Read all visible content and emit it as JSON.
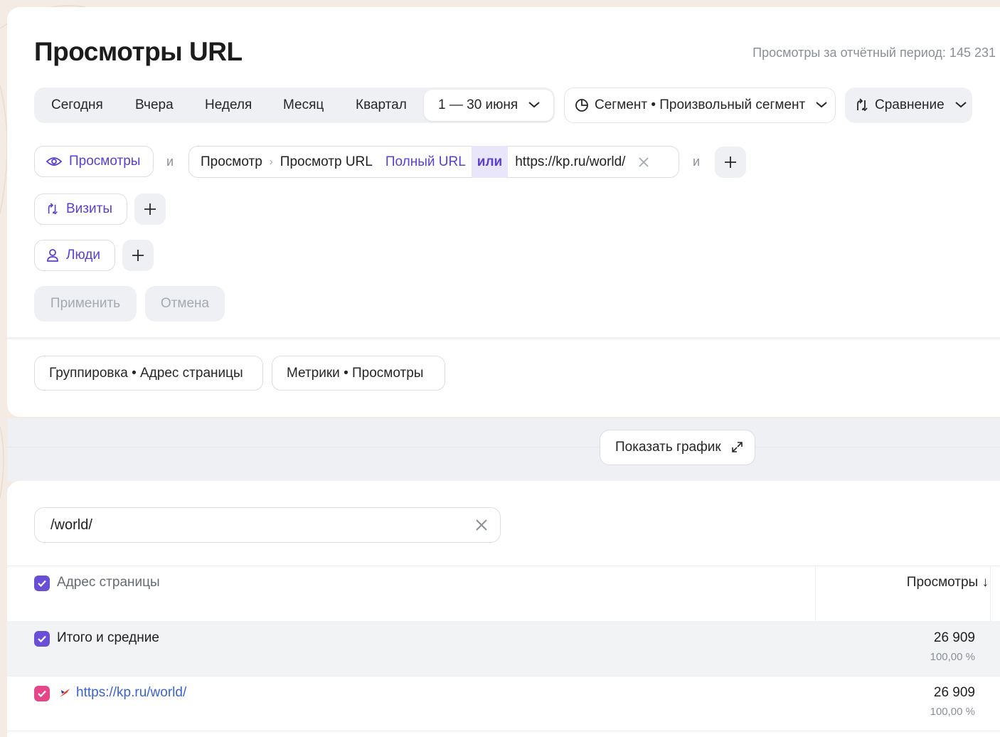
{
  "header": {
    "title": "Просмотры URL",
    "period_total": "Просмотры за отчётный период: 145 231"
  },
  "date_bar": {
    "today": "Сегодня",
    "yesterday": "Вчера",
    "week": "Неделя",
    "month": "Месяц",
    "quarter": "Квартал",
    "range": "1 — 30 июня"
  },
  "segment": {
    "label": "Сегмент • Произвольный сегмент"
  },
  "compare": {
    "label": "Сравнение"
  },
  "filters": {
    "views_chip": "Просмотры",
    "and": "и",
    "condition": {
      "crumb_1": "Просмотр",
      "crumb_2": "Просмотр URL",
      "field": "Полный URL",
      "operator": "или",
      "value": "https://kp.ru/world/"
    },
    "visits_chip": "Визиты",
    "people_chip": "Люди"
  },
  "actions": {
    "apply": "Применить",
    "cancel": "Отмена"
  },
  "settings": {
    "grouping": "Группировка • Адрес страницы",
    "metrics": "Метрики • Просмотры"
  },
  "chart_toggle": {
    "label": "Показать график"
  },
  "search": {
    "value": "/world/"
  },
  "table": {
    "header_dimension": "Адрес страницы",
    "header_metric": "Просмотры ↓",
    "rows": [
      {
        "label": "Итого и средние",
        "value": "26 909",
        "share": "100,00 %"
      },
      {
        "label": "https://kp.ru/world/",
        "value": "26 909",
        "share": "100,00 %"
      }
    ]
  },
  "colors": {
    "accent_purple": "#5b3fcf",
    "checkbox_purple": "#6a4fd6",
    "checkbox_pink": "#e54688",
    "link_blue": "#3a63d6"
  },
  "icons": [
    "eye-icon",
    "visits-icon",
    "person-icon",
    "plus-icon",
    "close-icon",
    "chevron-down-icon",
    "segment-pie-icon",
    "compare-icon",
    "expand-icon",
    "check-icon",
    "favicon-icon",
    "sort-down-icon"
  ]
}
